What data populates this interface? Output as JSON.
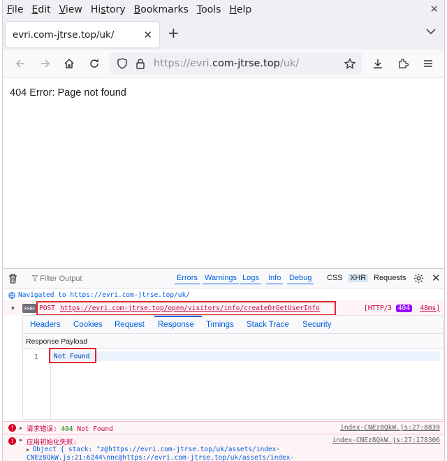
{
  "menubar": {
    "items": [
      "File",
      "Edit",
      "View",
      "History",
      "Bookmarks",
      "Tools",
      "Help"
    ],
    "accesskeys": [
      "F",
      "E",
      "V",
      "s",
      "B",
      "T",
      "H"
    ]
  },
  "tab": {
    "title": "evri.com-jtrse.top/uk/"
  },
  "urlbar": {
    "prefix": "https://evri.",
    "domain": "com-jtrse.top",
    "suffix": "/uk/"
  },
  "page": {
    "message": "404 Error: Page not found"
  },
  "devtools": {
    "filter_placeholder": "Filter Output",
    "filters": [
      "Errors",
      "Warnings",
      "Logs",
      "Info",
      "Debug"
    ],
    "toggles": [
      "CSS",
      "XHR",
      "Requests"
    ],
    "navigated": "Navigated to https://evri.com-jtrse.top/uk/",
    "xhr": {
      "badge": "XHR",
      "method": "POST",
      "url": "https://evri.com-jtrse.top/open/visitors/info/createOrGetUserInfo",
      "protocol": "[HTTP/3",
      "status": "404",
      "time": "48ms]"
    },
    "net_tabs": [
      "Headers",
      "Cookies",
      "Request",
      "Response",
      "Timings",
      "Stack Trace",
      "Security"
    ],
    "payload_title": "Response Payload",
    "payload_line_no": "1",
    "payload_text": "Not Found",
    "errors": [
      {
        "prefix": "请求错误: ",
        "code": "404",
        "rest": " Not Found",
        "source": "index-CNEz8QkW.js:27:8839"
      },
      {
        "prefix": "应用初始化失败:",
        "source": "index-CNEz8QkW.js:27:178306",
        "object_line": "Object { stack: \"z@https://evri.com-jtrse.top/uk/assets/index-",
        "object_line2": "CNEz8QkW.js:21:6244\\nnc@https://evri.com-jtrse.top/uk/assets/index-"
      }
    ]
  },
  "colors": {
    "accent": "#0060df",
    "error": "#c50042",
    "highlight_box": "#e0282e",
    "badge_404": "#9400ff"
  }
}
